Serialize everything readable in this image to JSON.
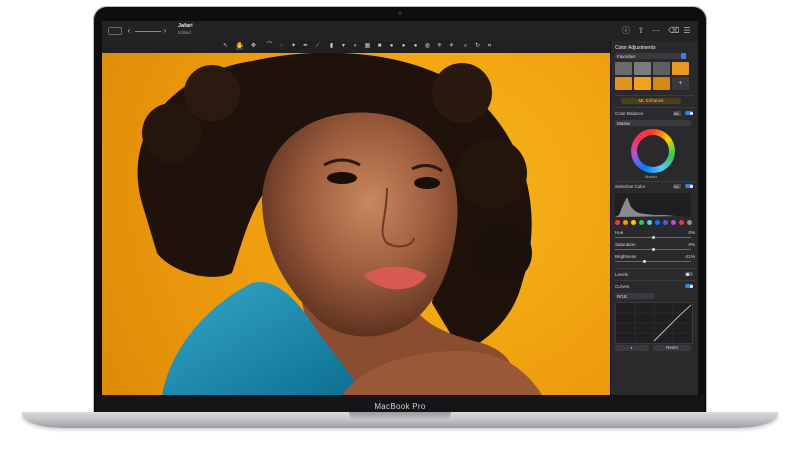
{
  "device": {
    "bezel_label": "MacBook Pro"
  },
  "window": {
    "doc_title": "Jafari",
    "doc_subtitle": "Edited",
    "titlebar_icons": [
      "sidebar-toggle-icon",
      "zoom-out-icon",
      "zoom-slider",
      "info-icon",
      "share-icon",
      "more-icon",
      "trash-icon",
      "adjust-icon"
    ]
  },
  "toolbar": {
    "tools": [
      "arrow-tool-icon",
      "hand-tool-icon",
      "move-tool-icon",
      "brush-tool-icon",
      "lasso-tool-icon",
      "magic-wand-icon",
      "pen-tool-icon",
      "eyedropper-icon",
      "stamp-tool-icon",
      "bucket-tool-icon",
      "gradient-tool-icon",
      "crop-overlay-icon",
      "shape-tool-icon",
      "text-tool-icon",
      "circle-tool-icon",
      "circle2-tool-icon",
      "circle3-tool-icon",
      "light-tool-icon",
      "sun-tool-icon",
      "zoom-tool-icon",
      "rotate-tool-icon",
      "crop-tool-icon"
    ]
  },
  "panel": {
    "title": "Color Adjustments",
    "favorites_label": "Favorites",
    "ml_enhance_label": "ML Enhance",
    "color_balance": {
      "label": "Color Balance",
      "badge": "ML",
      "channel": "Master",
      "wheel_label": "Master"
    },
    "selective_color": {
      "label": "Selective Color",
      "badge": "ML"
    },
    "swatch_colors": [
      "#ff3b30",
      "#ff9500",
      "#ffcc00",
      "#34c759",
      "#5ac8fa",
      "#007aff",
      "#5856d6",
      "#af52de",
      "#ff2d55",
      "#8e8e93"
    ],
    "sliders": [
      {
        "label": "Hue",
        "value": "0%",
        "level": 0.5
      },
      {
        "label": "Saturation",
        "value": "0%",
        "level": 0.5
      },
      {
        "label": "Brightness",
        "value": "-21%",
        "level": 0.39
      }
    ],
    "levels_label": "Levels",
    "curves": {
      "label": "Curves",
      "channel": "RGB"
    },
    "reset_label": "Reset"
  }
}
